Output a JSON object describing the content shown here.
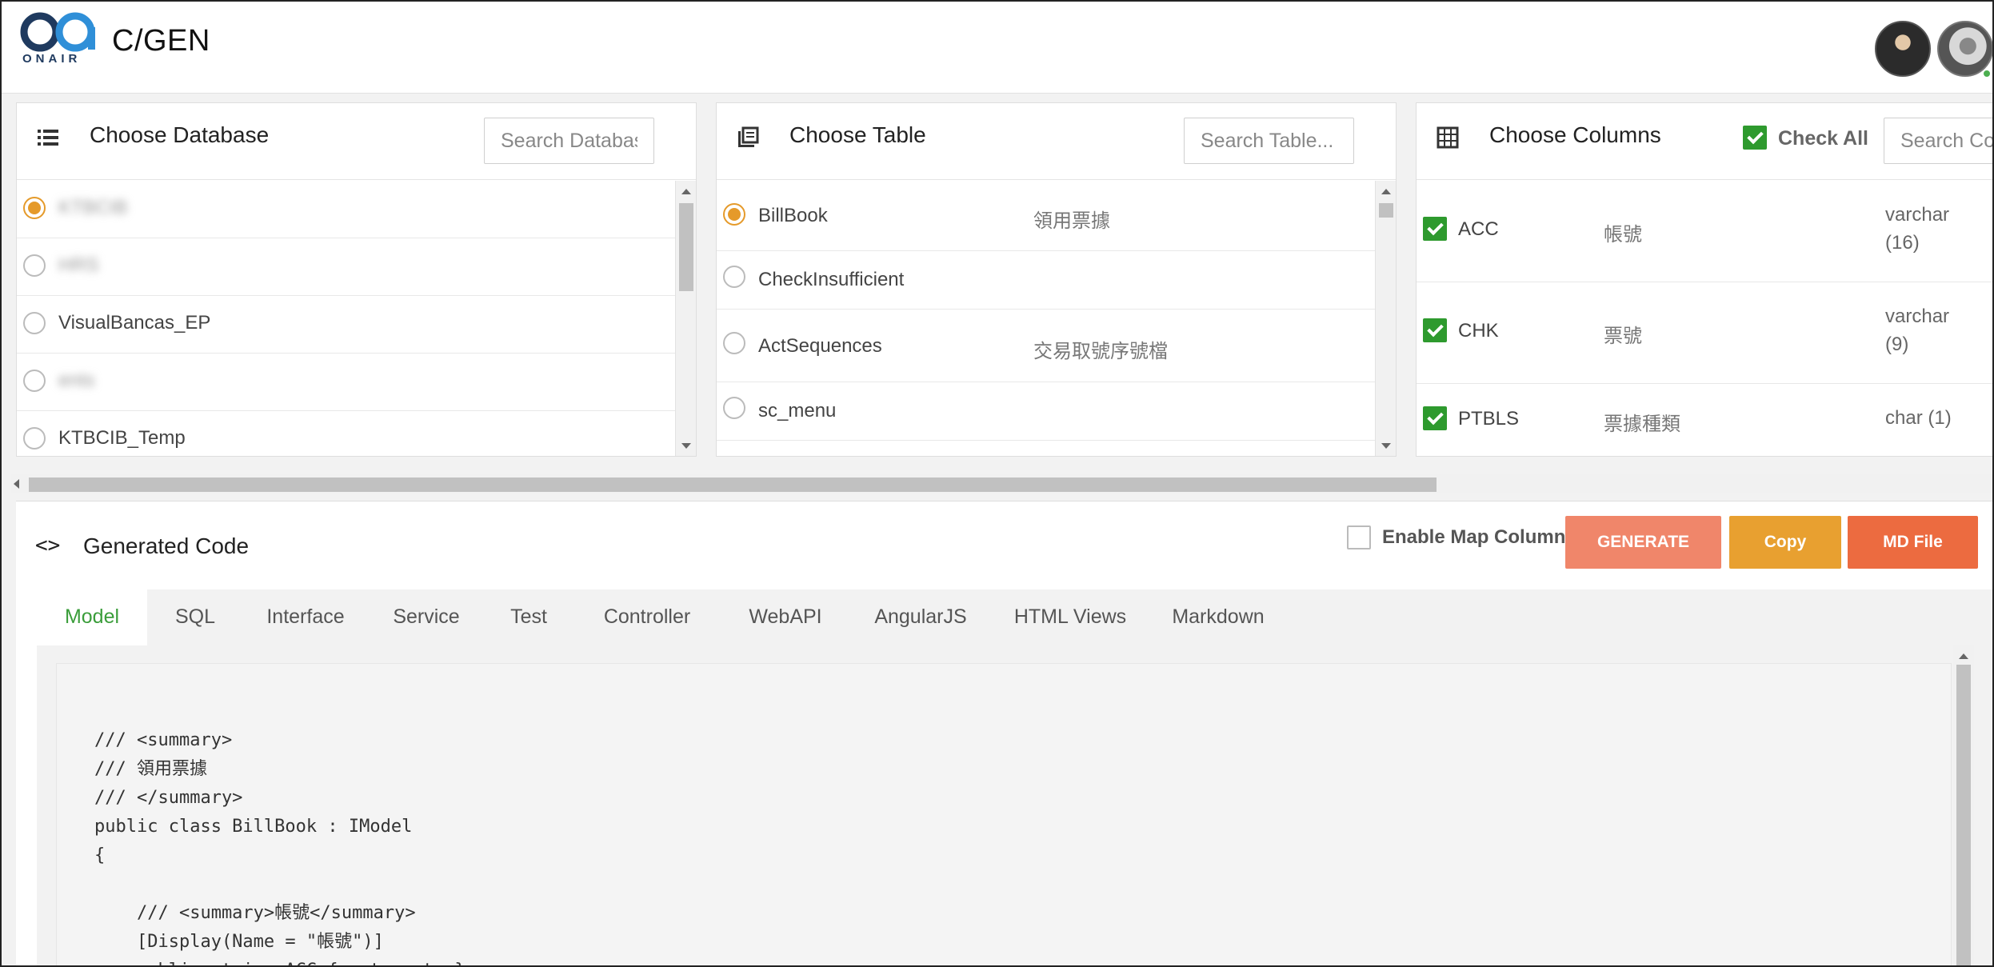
{
  "header": {
    "logo_text": "ONAIR",
    "title": "C/GEN"
  },
  "database_panel": {
    "title": "Choose Database",
    "icon": "list-icon",
    "search_placeholder": "Search Databas",
    "items": [
      {
        "label": "KTBCIB",
        "selected": true,
        "obscured": true
      },
      {
        "label": "HRS",
        "selected": false,
        "obscured": true
      },
      {
        "label": "VisualBancas_EP",
        "selected": false,
        "obscured": "partial"
      },
      {
        "label": "ents",
        "selected": false,
        "obscured": true
      },
      {
        "label": "KTBCIB_Temp",
        "selected": false,
        "obscured": false
      }
    ]
  },
  "table_panel": {
    "title": "Choose Table",
    "icon": "book-stack-icon",
    "search_placeholder": "Search Table...",
    "items": [
      {
        "name": "BillBook",
        "desc": "領用票據",
        "selected": true
      },
      {
        "name": "CheckInsufficient",
        "desc": "",
        "selected": false
      },
      {
        "name": "ActSequences",
        "desc": "交易取號序號檔",
        "selected": false
      },
      {
        "name": "sc_menu",
        "desc": "",
        "selected": false
      }
    ]
  },
  "columns_panel": {
    "title": "Choose Columns",
    "icon": "table-grid-icon",
    "check_all_label": "Check All",
    "check_all_checked": true,
    "search_placeholder": "Search Col",
    "items": [
      {
        "name": "ACC",
        "desc": "帳號",
        "type_line1": "varchar",
        "type_line2": "(16)",
        "checked": true
      },
      {
        "name": "CHK",
        "desc": "票號",
        "type_line1": "varchar",
        "type_line2": "(9)",
        "checked": true
      },
      {
        "name": "PTBLS",
        "desc": "票據種類",
        "type_line1": "char (1)",
        "type_line2": "",
        "checked": true
      }
    ]
  },
  "generated": {
    "icon": "code-brackets-icon",
    "icon_glyph": "<>",
    "title": "Generated Code",
    "map_column_label": "Enable Map Column",
    "map_column_checked": false,
    "buttons": {
      "generate": "GENERATE",
      "copy": "Copy",
      "md_file": "MD File"
    },
    "colors": {
      "generate": "#f0866a",
      "copy": "#e8a030",
      "md_file": "#ec6b40",
      "active_tab": "#3a9d3a",
      "radio_selected": "#e59a2a",
      "checkbox": "#2e9a2e"
    },
    "tabs": [
      "Model",
      "SQL",
      "Interface",
      "Service",
      "Test",
      "Controller",
      "WebAPI",
      "AngularJS",
      "HTML Views",
      "Markdown"
    ],
    "active_tab": "Model",
    "code_lines": [
      "/// <summary>",
      "/// 領用票據",
      "/// </summary>",
      "public class BillBook : IModel",
      "{",
      "",
      "    /// <summary>帳號</summary>",
      "    [Display(Name = \"帳號\")]",
      "    public string ACC { get; set; }"
    ]
  }
}
